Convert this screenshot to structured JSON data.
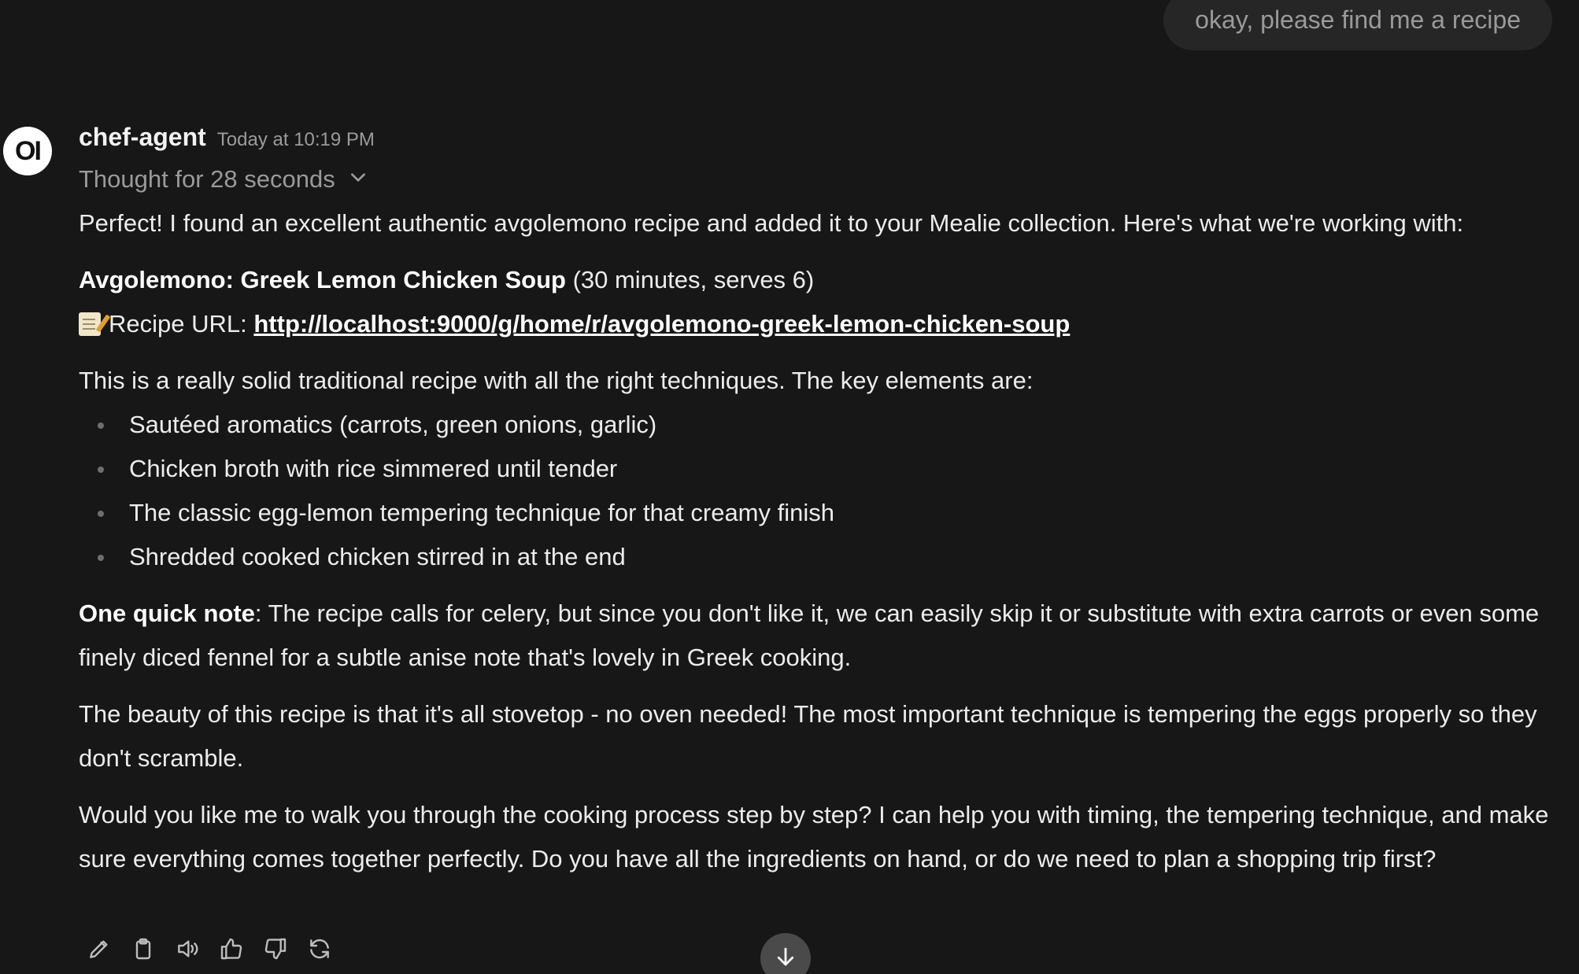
{
  "user_message": "okay, please find me a recipe",
  "assistant": {
    "avatar_text": "OI",
    "name": "chef-agent",
    "timestamp": "Today at 10:19 PM",
    "thought_label": "Thought for 28 seconds",
    "intro": "Perfect! I found an excellent authentic avgolemono recipe and added it to your Mealie collection. Here's what we're working with:",
    "recipe_title": "Avgolemono: Greek Lemon Chicken Soup",
    "recipe_meta": " (30 minutes, serves 6)",
    "recipe_url_label": "Recipe URL: ",
    "recipe_url": "http://localhost:9000/g/home/r/avgolemono-greek-lemon-chicken-soup",
    "key_intro": "This is a really solid traditional recipe with all the right techniques. The key elements are:",
    "key_elements": [
      "Sautéed aromatics (carrots, green onions, garlic)",
      "Chicken broth with rice simmered until tender",
      "The classic egg-lemon tempering technique for that creamy finish",
      "Shredded cooked chicken stirred in at the end"
    ],
    "note_label": "One quick note",
    "note_text": ": The recipe calls for celery, but since you don't like it, we can easily skip it or substitute with extra carrots or even some finely diced fennel for a subtle anise note that's lovely in Greek cooking.",
    "beauty_text": "The beauty of this recipe is that it's all stovetop - no oven needed! The most important technique is tempering the eggs properly so they don't scramble.",
    "ask_text": "Would you like me to walk you through the cooking process step by step? I can help you with timing, the tempering technique, and make sure everything comes together perfectly. Do you have all the ingredients on hand, or do we need to plan a shopping trip first?"
  },
  "actions": [
    "edit-icon",
    "copy-icon",
    "read-aloud-icon",
    "thumbs-up-icon",
    "thumbs-down-icon",
    "regenerate-icon"
  ],
  "scroll_button_icon": "arrow-down-icon"
}
